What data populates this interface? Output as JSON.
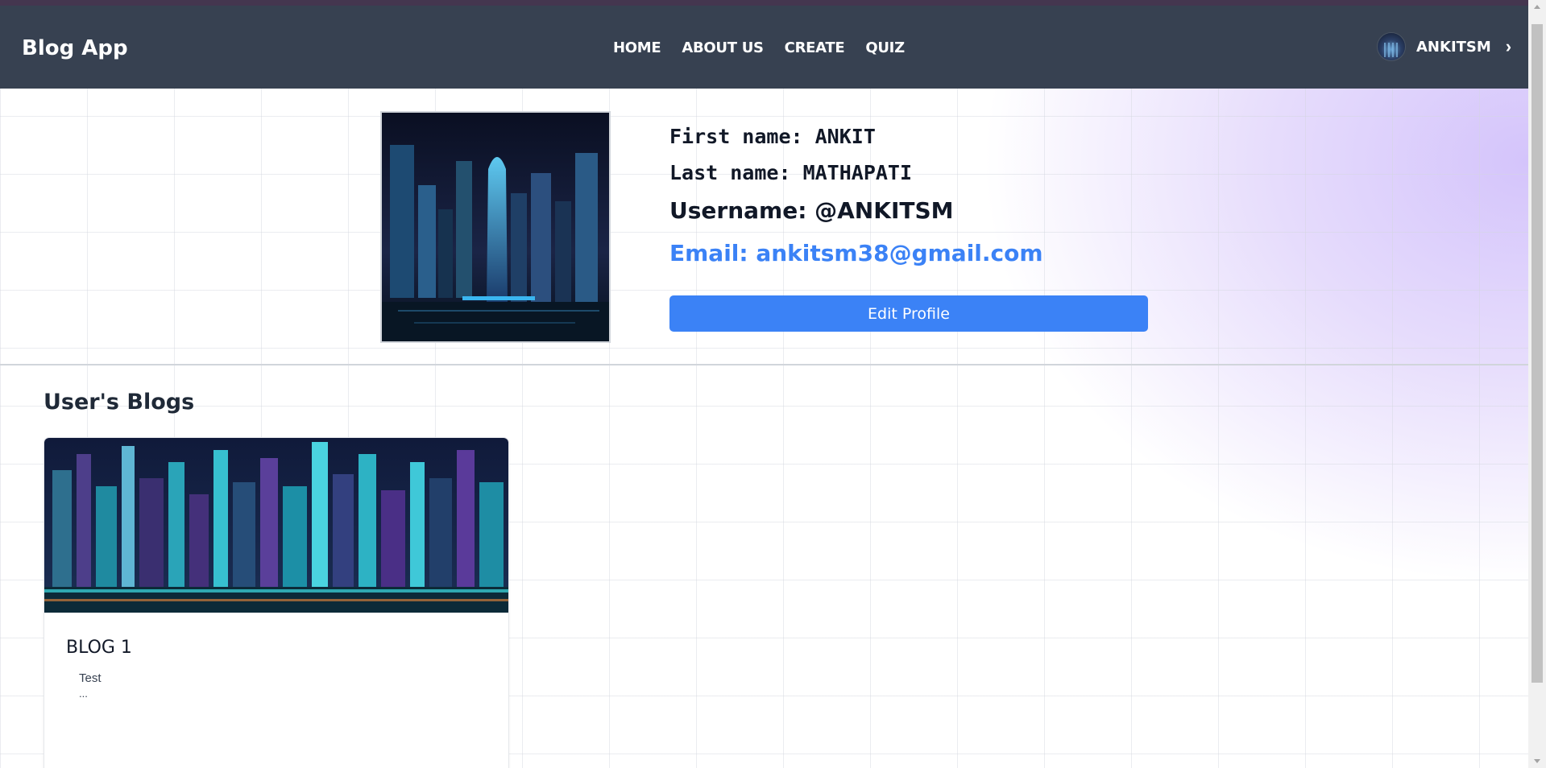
{
  "navbar": {
    "brand": "Blog App",
    "links": [
      {
        "label": "HOME"
      },
      {
        "label": "ABOUT US"
      },
      {
        "label": "CREATE"
      },
      {
        "label": "QUIZ"
      }
    ],
    "user": {
      "name": "ANKITSM",
      "avatar_icon": "avatar-image",
      "chevron_icon": "chevron-right-icon"
    },
    "background": "#374151"
  },
  "profile": {
    "first_name": "First name: ANKIT",
    "last_name": "Last name: MATHAPATI",
    "username": "Username: @ANKITSM",
    "email": "Email: ankitsm38@gmail.com",
    "edit_button": "Edit Profile",
    "accent": "#3b82f6"
  },
  "blogs": {
    "section_title": "User's Blogs",
    "items": [
      {
        "title": "BLOG 1",
        "excerpt": "Test",
        "ellipsis": "..."
      }
    ]
  }
}
